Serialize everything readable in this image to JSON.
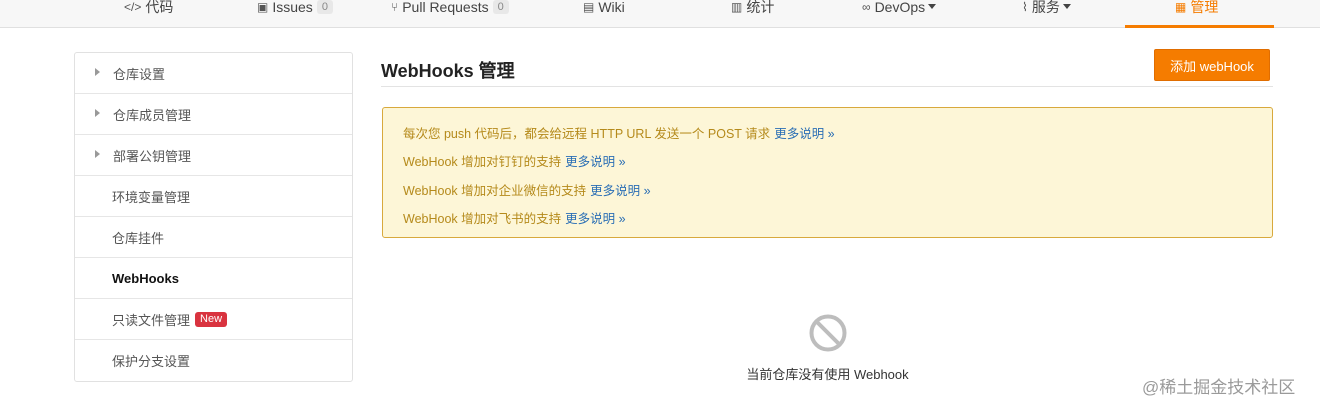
{
  "nav": {
    "items": [
      {
        "icon": "</>",
        "label": "代码"
      },
      {
        "icon": "▣",
        "label": "Issues",
        "count": "0"
      },
      {
        "icon": "⑂",
        "label": "Pull Requests",
        "count": "0"
      },
      {
        "icon": "▤",
        "label": "Wiki"
      },
      {
        "icon": "▥",
        "label": "统计"
      },
      {
        "icon": "∞",
        "label": "DevOps"
      },
      {
        "icon": "⌇",
        "label": "服务"
      },
      {
        "icon": "▦",
        "label": "管理"
      }
    ]
  },
  "sidebar": {
    "items": [
      {
        "label": "仓库设置"
      },
      {
        "label": "仓库成员管理"
      },
      {
        "label": "部署公钥管理"
      },
      {
        "label": "环境变量管理"
      },
      {
        "label": "仓库挂件"
      },
      {
        "label": "WebHooks"
      },
      {
        "label": "只读文件管理",
        "badge": "New"
      },
      {
        "label": "保护分支设置"
      }
    ]
  },
  "main": {
    "title": "WebHooks 管理",
    "add_button": "添加 webHook",
    "notice": [
      {
        "text": "每次您 push 代码后，都会给远程 HTTP URL 发送一个 POST 请求",
        "link": "更多说明 »"
      },
      {
        "text": "WebHook 增加对钉钉的支持",
        "link": "更多说明 »"
      },
      {
        "text": "WebHook 增加对企业微信的支持",
        "link": "更多说明 »"
      },
      {
        "text": "WebHook 增加对飞书的支持",
        "link": "更多说明 »"
      }
    ],
    "empty_text": "当前仓库没有使用 Webhook"
  },
  "watermark": "@稀土掘金技术社区"
}
